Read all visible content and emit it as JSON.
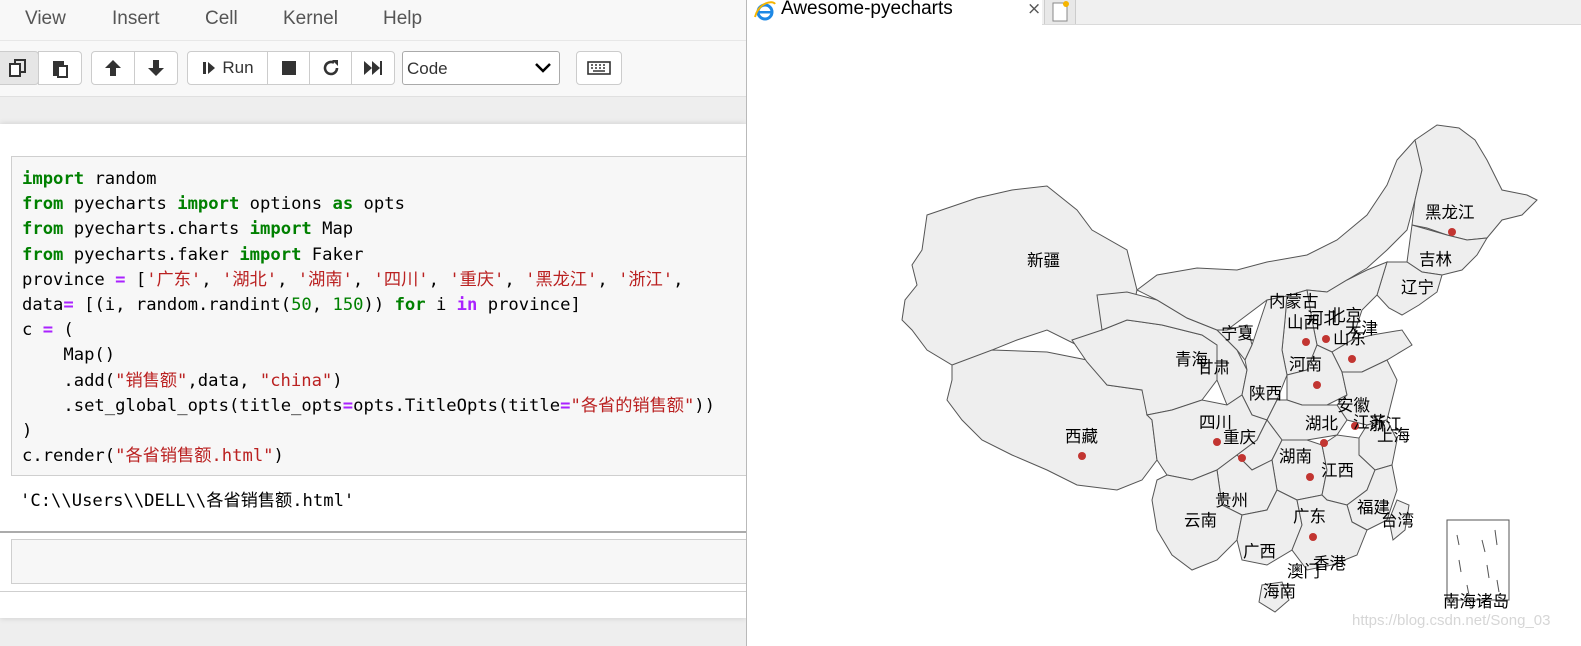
{
  "menu": [
    "View",
    "Insert",
    "Cell",
    "Kernel",
    "Help"
  ],
  "toolbar": {
    "run_label": "Run",
    "cell_type": "Code"
  },
  "code_lines": [
    "import random",
    "from pyecharts import options as opts",
    "from pyecharts.charts import Map",
    "from pyecharts.faker import Faker",
    "province = ['广东', '湖北', '湖南', '四川', '重庆', '黑龙江', '浙江',",
    "data= [(i, random.randint(50, 150)) for i in province]",
    "c = (",
    "    Map()",
    "    .add(\"销售额\",data, \"china\")",
    "    .set_global_opts(title_opts=opts.TitleOpts(title=\"各省的销售额\"))",
    ")",
    "c.render(\"各省销售额.html\")"
  ],
  "output_text": "'C:\\\\Users\\\\DELL\\\\各省销售额.html'",
  "browser": {
    "tab_title": "Awesome-pyecharts",
    "close_glyph": "×"
  },
  "map": {
    "point_color": "#c23531",
    "region_fill": "#eeeeee",
    "border_color": "#555555",
    "labels": [
      "黑龙江",
      "吉林",
      "辽宁",
      "新疆",
      "内蒙古",
      "北京",
      "天津",
      "山西",
      "河北",
      "山东",
      "宁夏",
      "青海",
      "甘肃",
      "河南",
      "陕西",
      "安徽",
      "湖北",
      "江苏",
      "浙江",
      "上海",
      "四川",
      "重庆",
      "西藏",
      "湖南",
      "江西",
      "贵州",
      "福建",
      "台湾",
      "云南",
      "广东",
      "广西",
      "香港",
      "澳门",
      "海南",
      "南海诸岛"
    ],
    "marked_provinces": [
      "黑龙江",
      "山西",
      "北京",
      "山东",
      "河南",
      "湖北",
      "浙江",
      "四川",
      "重庆",
      "湖南",
      "广东",
      "西藏"
    ]
  },
  "watermark": "https://blog.csdn.net/Song_03"
}
